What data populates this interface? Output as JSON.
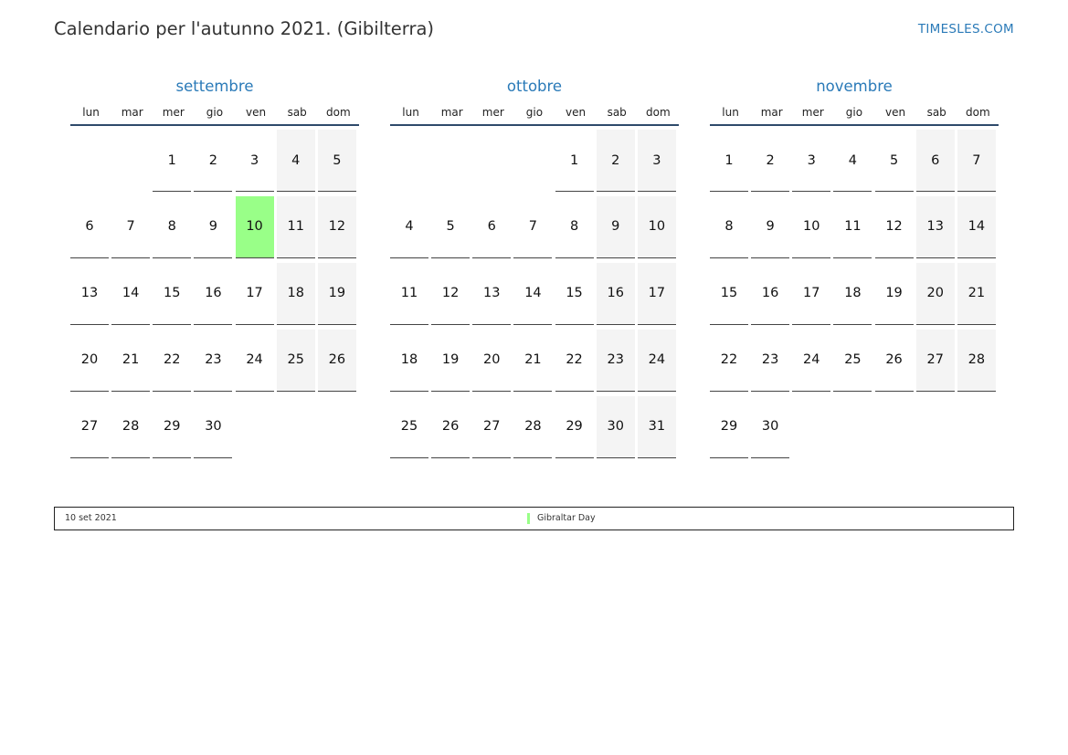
{
  "header": {
    "title": "Calendario per l'autunno 2021. (Gibilterra)",
    "site": "TIMESLES.COM"
  },
  "weekdays": [
    "lun",
    "mar",
    "mer",
    "gio",
    "ven",
    "sab",
    "dom"
  ],
  "colors": {
    "accent": "#2a7ab8",
    "holiday": "#99ff88",
    "weekend": "#f4f4f4"
  },
  "months": [
    {
      "name": "settembre",
      "first_weekday_index": 2,
      "days": 30,
      "holidays": [
        10
      ]
    },
    {
      "name": "ottobre",
      "first_weekday_index": 4,
      "days": 31,
      "holidays": []
    },
    {
      "name": "novembre",
      "first_weekday_index": 0,
      "days": 30,
      "holidays": []
    }
  ],
  "legend": {
    "date": "10 set 2021",
    "name": "Gibraltar Day"
  }
}
